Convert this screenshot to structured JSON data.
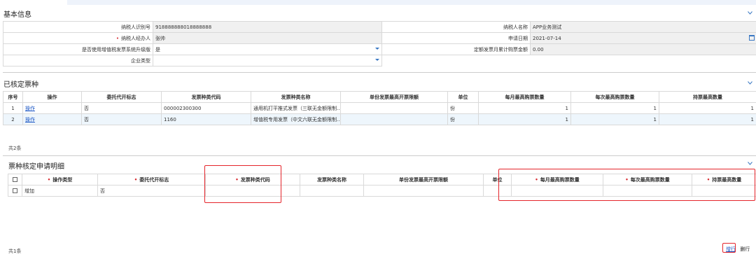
{
  "sections": {
    "basic": "基本信息",
    "approved": "已核定票种",
    "detail": "票种核定申请明细"
  },
  "basic_info": {
    "taxpayer_id_label": "纳税人识别号",
    "taxpayer_id": "918888888018888888",
    "taxpayer_name_label": "纳税人名称",
    "taxpayer_name": "APP业务测试",
    "agent_label": "纳税人经办人",
    "agent": "张帅",
    "apply_date_label": "申请日期",
    "apply_date": "2021-07-14",
    "vat_upgrade_label": "是否使用增值税发票系统升级版",
    "vat_upgrade": "是",
    "fixed_amount_label": "定额发票月累计购票金额",
    "fixed_amount": "0.00",
    "enterprise_type_label": "企业类型",
    "enterprise_type": ""
  },
  "approved_table": {
    "headers": [
      "序号",
      "操作",
      "委托代开标志",
      "发票种类代码",
      "发票种类名称",
      "单份发票最高开票限额",
      "单位",
      "每月最高购票数量",
      "每次最高购票数量",
      "持票最高数量"
    ],
    "rows": [
      {
        "no": "1",
        "op": "操作",
        "entrust": "否",
        "code": "000002300300",
        "name": "通用机打平推式发票（三联无金额限制...",
        "limit": "",
        "unit": "份",
        "monthly": "1",
        "each": "1",
        "hold": "1"
      },
      {
        "no": "2",
        "op": "操作",
        "entrust": "否",
        "code": "1160",
        "name": "增值税专用发票（中文六联无金额限制...",
        "limit": "",
        "unit": "份",
        "monthly": "1",
        "each": "1",
        "hold": "1"
      }
    ],
    "count": "共2条"
  },
  "detail_table": {
    "headers": [
      "操作类型",
      "委托代开标志",
      "发票种类代码",
      "发票种类名称",
      "单份发票最高开票限额",
      "单位",
      "每月最高购票数量",
      "每次最高购票数量",
      "持票最高数量"
    ],
    "rows": [
      {
        "op_type": "增加",
        "entrust": "否",
        "code": "",
        "name": "",
        "limit": "",
        "unit": "",
        "monthly": "",
        "each": "",
        "hold": ""
      }
    ],
    "count": "共1条",
    "add_row": "增行",
    "delete_row": "删行"
  },
  "colors": {
    "required": "#d8262d",
    "link": "#1a55c4",
    "highlight": "#e5252b"
  }
}
